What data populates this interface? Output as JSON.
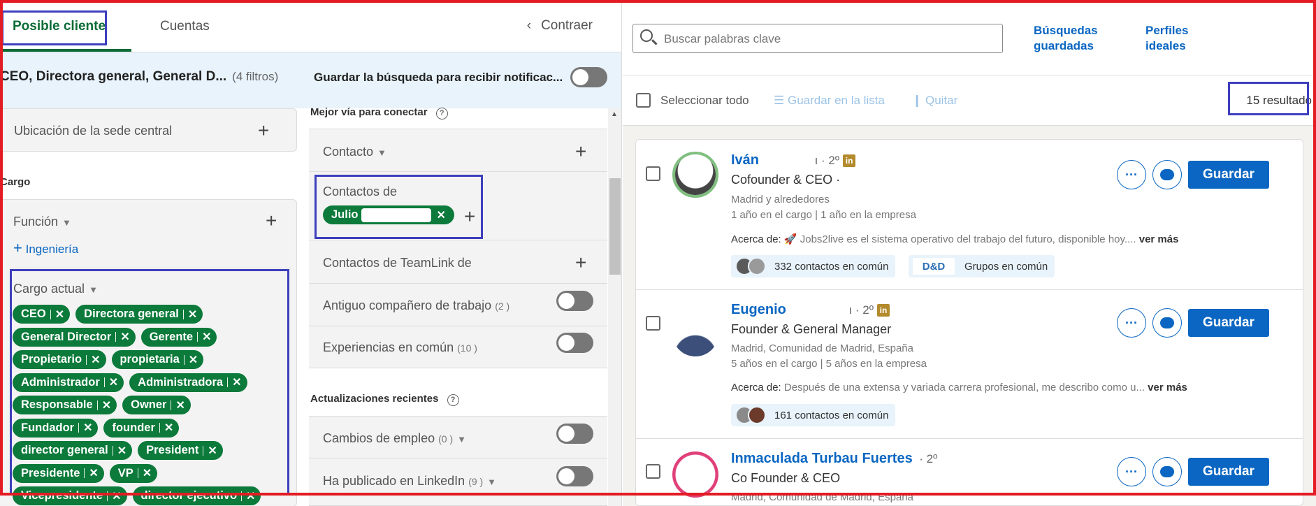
{
  "tabs": {
    "lead": "Posible cliente",
    "accounts": "Cuentas",
    "collapse": "Contraer"
  },
  "summary": {
    "title": "CEO, Directora general, General D...",
    "filter_count": "(4 filtros)",
    "save_search": "Guardar la búsqueda para recibir notificac..."
  },
  "filters": {
    "hq_location": "Ubicación de la sede central",
    "cargo_section": "Cargo",
    "function_label": "Función",
    "function_add": "Ingeniería",
    "current_title_label": "Cargo actual",
    "current_title_chips": [
      [
        "CEO",
        "Directora general"
      ],
      [
        "General Director",
        "Gerente"
      ],
      [
        "Propietario",
        "propietaria"
      ],
      [
        "Administrador",
        "Administradora"
      ],
      [
        "Responsable",
        "Owner"
      ],
      [
        "Fundador",
        "founder"
      ],
      [
        "director general",
        "President"
      ],
      [
        "Presidente",
        "VP"
      ],
      [
        "Vicepresidente",
        "director ejecutivo"
      ]
    ]
  },
  "connect": {
    "best_path": "Mejor vía para conectar",
    "contact": "Contacto",
    "contacts_of": "Contactos de",
    "contacts_of_chip": "Julio",
    "teamlink": "Contactos de TeamLink de",
    "past_colleague": "Antiguo compañero de trabajo",
    "past_colleague_count": "(2 )",
    "shared_exp": "Experiencias en común",
    "shared_exp_count": "(10 )",
    "recent_updates": "Actualizaciones recientes",
    "job_changes": "Cambios de empleo",
    "job_changes_count": "(0 )",
    "posted": "Ha publicado en LinkedIn",
    "posted_count": "(9 )"
  },
  "search": {
    "placeholder": "Buscar palabras clave",
    "saved_searches": [
      "Búsquedas",
      "guardadas"
    ],
    "ideal_profiles": [
      "Perfiles",
      "ideales"
    ]
  },
  "actions": {
    "select_all": "Seleccionar todo",
    "save_to_list": "Guardar en la lista",
    "remove": "Quitar",
    "results": "15 resultado"
  },
  "leads": [
    {
      "name": "Iván",
      "degree": "ı · 2º",
      "title": "Cofounder & CEO ·",
      "location": "Madrid y alrededores",
      "tenure": "1 año en el cargo | 1 año en la empresa",
      "about_label": "Acerca de:",
      "about": "🚀 Jobs2live es el sistema operativo del trabajo del futuro, disponible hoy....",
      "more": "ver más",
      "shared": "332 contactos en común",
      "groups": "Grupos en común",
      "group_logo": "D&D"
    },
    {
      "name": "Eugenio",
      "degree": "ı · 2º",
      "title": "Founder & General Manager",
      "location": "Madrid, Comunidad de Madrid, España",
      "tenure": "5 años en el cargo | 5 años en la empresa",
      "about_label": "Acerca de:",
      "about": "Después de una extensa y variada carrera profesional, me describo como u...",
      "more": "ver más",
      "shared": "161 contactos en común"
    },
    {
      "name": "Inmaculada Turbau Fuertes",
      "degree": "· 2º",
      "title": "Co Founder & CEO",
      "location": "Madrid, Comunidad de Madrid, España"
    }
  ],
  "buttons": {
    "save": "Guardar"
  },
  "icons": {
    "badge": "in",
    "more": "···",
    "message": "message-icon",
    "pin": "pin-icon"
  },
  "colors": {
    "accent_green": "#0c7a3a",
    "linkedin_blue": "#0a66c2",
    "highlight_red": "#e31b23",
    "highlight_blue": "#3d3fbd"
  }
}
